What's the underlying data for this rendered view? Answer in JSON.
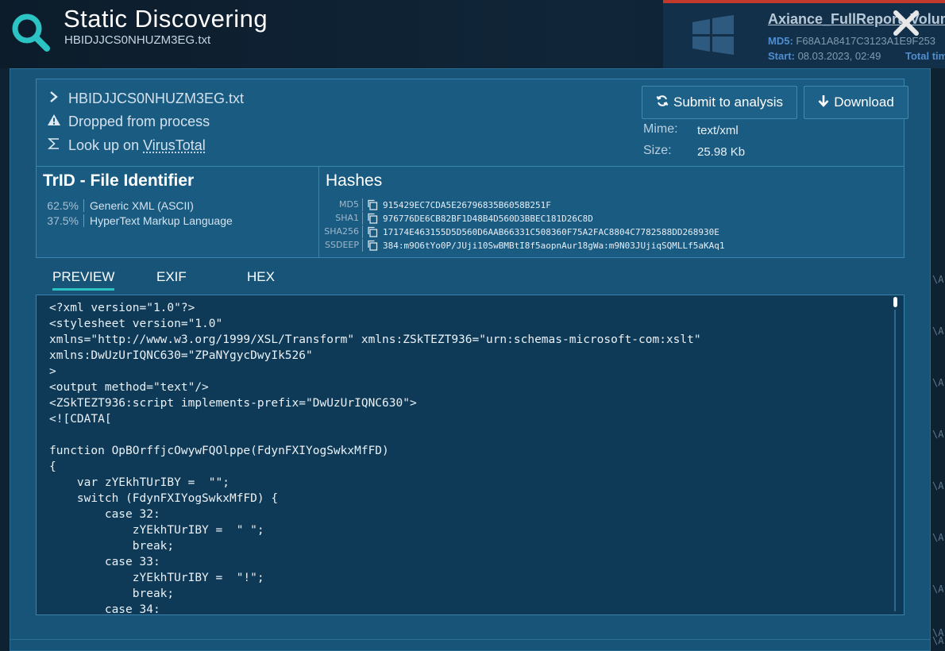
{
  "header": {
    "title": "Static Discovering",
    "subtitle": "HBIDJJCS0NHUZM3EG.txt"
  },
  "background": {
    "report_title": "Axiance_FullReport_Volume.",
    "md5_label": "MD5:",
    "md5_value": "F68A1A8417C3123A1E9F253",
    "start_label": "Start:",
    "start_value": "08.03.2023, 02:49",
    "total_label": "Total tim",
    "side_marks": [
      "\\A",
      "\\A",
      "\\A",
      "\\A",
      "\\A",
      "\\A",
      "\\A",
      "\\A",
      "\\A"
    ]
  },
  "file": {
    "name": "HBIDJJCS0NHUZM3EG.txt",
    "origin": "Dropped from process",
    "lookup_prefix": "Look up on ",
    "lookup_link": "VirusTotal",
    "mime_label": "Mime:",
    "mime_value": "text/xml",
    "size_label": "Size:",
    "size_value": "25.98 Kb"
  },
  "buttons": {
    "submit": "Submit to analysis",
    "download": "Download"
  },
  "trid": {
    "title": "TrID - File Identifier",
    "rows": [
      {
        "pct": "62.5%",
        "name": "Generic XML (ASCII)"
      },
      {
        "pct": "37.5%",
        "name": "HyperText Markup Language"
      }
    ]
  },
  "hashes": {
    "title": "Hashes",
    "rows": [
      {
        "key": "MD5",
        "value": "915429EC7CDA5E26796835B6058B251F"
      },
      {
        "key": "SHA1",
        "value": "976776DE6CB82BF1D48B4D560D3BBEC181D26C8D"
      },
      {
        "key": "SHA256",
        "value": "17174E463155D5D560D6AAB66331C508360F75A2FAC8804C7782588DD268930E"
      },
      {
        "key": "SSDEEP",
        "value": "384:m9O6tYo0P/JUji10SwBMBtI8f5aopnAur18gWa:m9N03JUjiqSQMLLf5aKAq1"
      }
    ]
  },
  "tabs": [
    "PREVIEW",
    "EXIF",
    "HEX"
  ],
  "preview": {
    "code": "<?xml version=\"1.0\"?>\n<stylesheet version=\"1.0\"\nxmlns=\"http://www.w3.org/1999/XSL/Transform\" xmlns:ZSkTEZT936=\"urn:schemas-microsoft-com:xslt\"\nxmlns:DwUzUrIQNC630=\"ZPaNYgycDwyIk526\"\n>\n<output method=\"text\"/>\n<ZSkTEZT936:script implements-prefix=\"DwUzUrIQNC630\">\n<![CDATA[\n\nfunction OpBOrffjcOwywFQOlppe(FdynFXIYogSwkxMfFD)\n{\n    var zYEkhTUrIBY =  \"\";\n    switch (FdynFXIYogSwkxMfFD) {\n        case 32:\n            zYEkhTUrIBY =  \" \";\n            break;\n        case 33:\n            zYEkhTUrIBY =  \"!\";\n            break;\n        case 34:"
  },
  "colors": {
    "accent": "#2bc3c3",
    "dialog_bg": "#175478",
    "preview_bg": "#0e3a57",
    "alert_bar": "#c0392b"
  },
  "icons": {
    "header": "search-icon",
    "close": "close-icon",
    "filename": "chevron-right-icon",
    "origin": "warning-icon",
    "lookup": "sigma-icon",
    "submit": "refresh-icon",
    "download": "arrow-down-icon",
    "hash_copy": "copy-icon",
    "os": "windows-logo-icon"
  }
}
